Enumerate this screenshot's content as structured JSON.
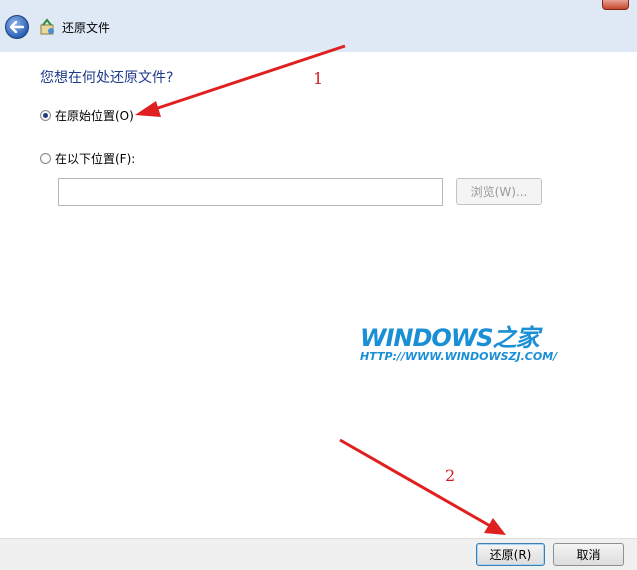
{
  "window": {
    "title": "还原文件"
  },
  "question": "您想在何处还原文件?",
  "options": {
    "original": {
      "label": "在原始位置(O)",
      "checked": true
    },
    "other": {
      "label": "在以下位置(F):",
      "checked": false
    }
  },
  "path_input": {
    "value": ""
  },
  "browse_label": "浏览(W)...",
  "watermark": {
    "logo": "WINDOWS之家",
    "url": "HTTP://WWW.WINDOWSZJ.COM/"
  },
  "annotations": {
    "step1": "1",
    "step2": "2"
  },
  "footer": {
    "restore_label": "还原(R)",
    "cancel_label": "取消"
  },
  "colors": {
    "question": "#1e3a8a",
    "annotation": "#d02020",
    "watermark": "#1a8fd6"
  }
}
